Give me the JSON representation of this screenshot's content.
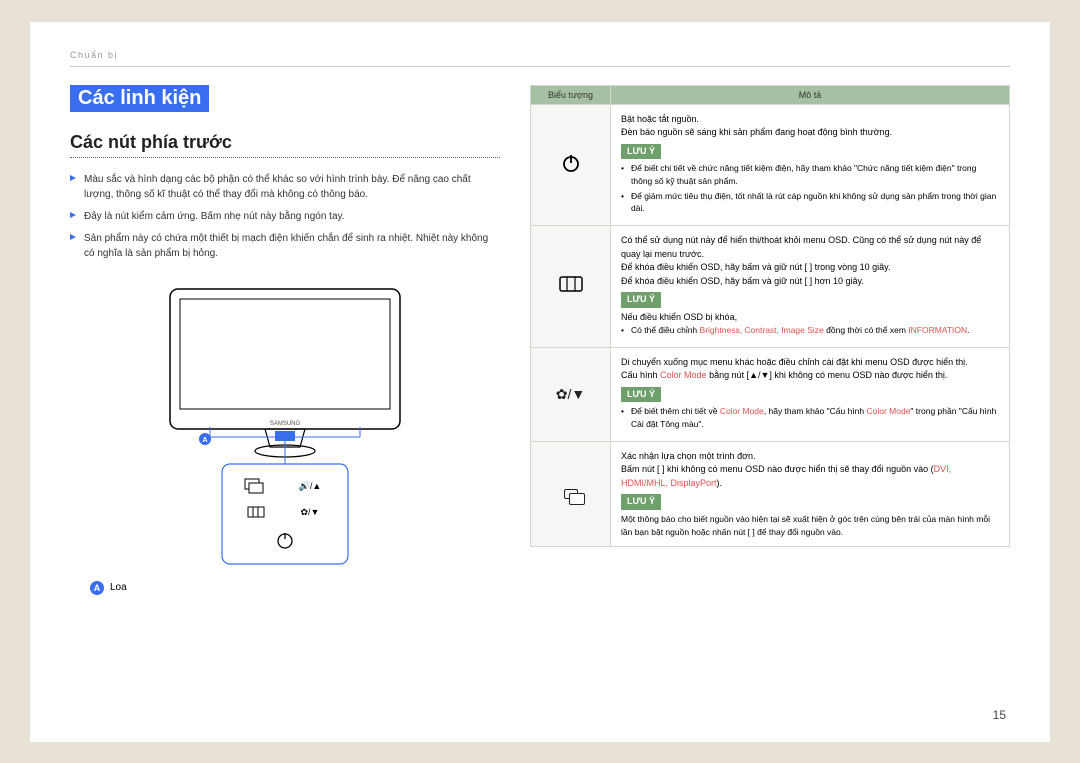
{
  "breadcrumb": "Chuẩn bị",
  "h1": "Các linh kiện",
  "h2": "Các nút phía trước",
  "bullets": [
    "Màu sắc và hình dạng các bộ phận có thể khác so với hình trình bày. Để nâng cao chất lượng, thông số kĩ thuật có thể thay đổi mà không có thông báo.",
    "Đây là nút kiểm cảm ứng. Bấm nhẹ nút này bằng ngón tay.",
    "Sản phẩm này có chứa một thiết bị mạch điện khiến chắn để sinh ra nhiệt. Nhiệt này không có nghĩa là sản phẩm bị hỏng."
  ],
  "legend_label": "Loa",
  "table_headers": {
    "icon": "Biểu tượng",
    "desc": "Mô tả"
  },
  "rows": {
    "power": {
      "lines": [
        "Bật hoặc tắt nguồn.",
        "Đèn báo nguồn sẽ sáng khi sản phẩm đang hoạt động bình thường."
      ],
      "note": "LƯU Ý",
      "subs": [
        "Để biết chi tiết về chức năng tiết kiệm điện, hãy tham khảo \"Chức năng tiết kiệm điện\" trong thông số kỹ thuật sản phẩm.",
        "Để giảm mức tiêu thụ điện, tốt nhất là rút cáp nguồn khi không sử dụng sản phẩm trong thời gian dài."
      ]
    },
    "menu": {
      "lines": [
        "Có thể sử dụng nút này để hiển thị/thoát khỏi menu OSD. Cũng có thể sử dụng nút này để quay lại menu trước.",
        "Để khóa điều khiển OSD, hãy bấm và giữ nút [   ] trong vòng 10 giây.",
        "Để khóa điều khiển OSD, hãy bấm và giữ nút [   ] hơn 10 giây."
      ],
      "note": "LƯU Ý",
      "note_msg": "Nếu điều khiển OSD bị khóa,",
      "subs_pre": "Có thể điều chỉnh ",
      "subs_terms": "Brightness, Contrast, Image Size",
      "subs_mid": " đồng thời có thể xem ",
      "subs_info": "INFORMATION",
      "subs_post": "."
    },
    "updown": {
      "line1": "Di chuyển xuống mục menu khác hoặc điều chỉnh cài đặt khi menu OSD được hiển thị.",
      "line2a": "Cấu hình ",
      "line2b": "Color Mode",
      "line2c": " bằng nút [▲/▼] khi không có menu OSD nào được hiển thị.",
      "note": "LƯU Ý",
      "sub_a": "Để biết thêm chi tiết về ",
      "sub_b": "Color Mode",
      "sub_c": ", hãy tham khảo \"Cấu hình ",
      "sub_d": "Color Mode",
      "sub_e": "\" trong phần \"Cấu hình Cài đặt Tông màu\"."
    },
    "source": {
      "line1": "Xác nhận lựa chọn một trình đơn.",
      "line2a": "Bấm nút [  ] khi không có menu OSD nào được hiển thị sẽ thay đổi nguồn vào (",
      "line2b": "DVI, HDMI/MHL, DisplayPort",
      "line2c": ").",
      "note": "LƯU Ý",
      "sub": "Một thông báo cho biết nguồn vào hiện tại sẽ xuất hiện ở góc trên cùng bên trái của màn hình mỗi lần bạn bật nguồn hoặc nhấn nút [  ] để thay đổi nguồn vào."
    }
  },
  "page_number": "15"
}
